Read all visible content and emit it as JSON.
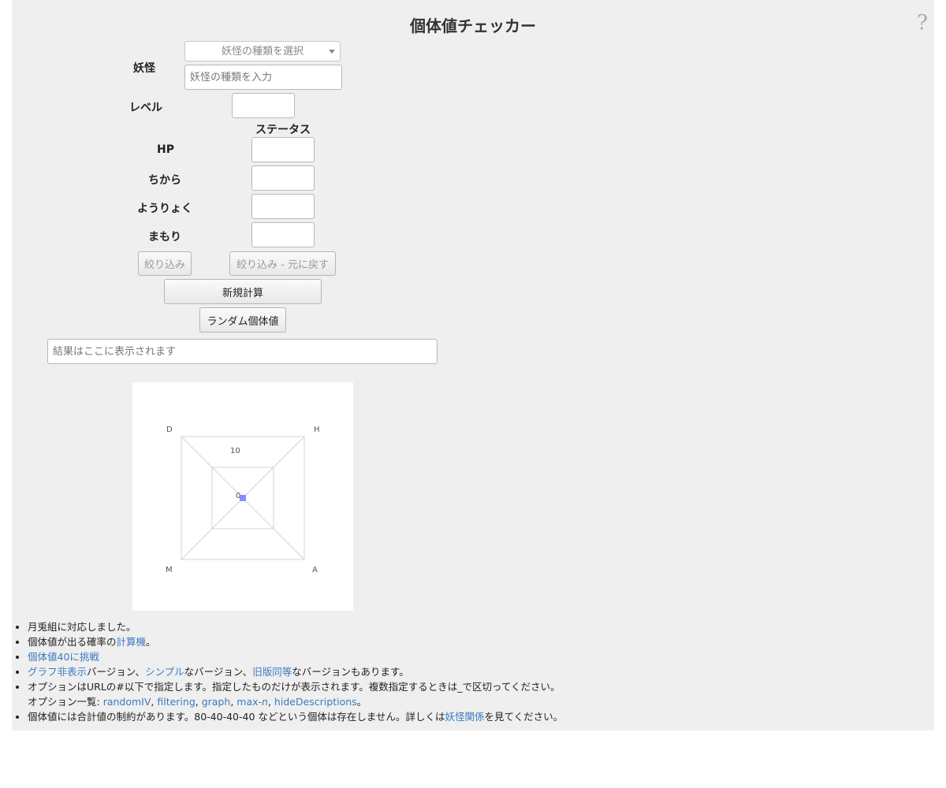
{
  "header": {
    "title": "個体値チェッカー",
    "help": "?"
  },
  "form": {
    "yokai_label": "妖怪",
    "species_select": "妖怪の種類を選択",
    "species_input_placeholder": "妖怪の種類を入力",
    "level_label": "レベル",
    "status_heading": "ステータス",
    "stats": [
      {
        "label": "HP"
      },
      {
        "label": "ちから"
      },
      {
        "label": "ようりょく"
      },
      {
        "label": "まもり"
      }
    ],
    "filter_button": "絞り込み",
    "filter_undo_button": "絞り込み - 元に戻す",
    "new_calc_button": "新規計算",
    "random_iv_button": "ランダム個体値",
    "result_placeholder": "結果はここに表示されます"
  },
  "graph": {
    "axes": [
      "H",
      "A",
      "M",
      "D"
    ],
    "ring_labels": [
      "10",
      "0"
    ],
    "point_color": "#8a8aff"
  },
  "notes": {
    "n1": "月兎組に対応しました。",
    "n2_pre": "個体値が出る確率の",
    "n2_link": "計算機",
    "n2_post": "。",
    "n3_link": "個体値40に挑戦",
    "n4_link1": "グラフ非表示",
    "n4_t1": "バージョン、",
    "n4_link2": "シンプル",
    "n4_t2": "なバージョン、",
    "n4_link3": "旧版同等",
    "n4_t3": "なバージョンもあります。",
    "n5_line1": "オプションはURLの#以下で指定します。指定したものだけが表示されます。複数指定するときは_で区切ってください。",
    "n5_prefix": "オプション一覧: ",
    "n5_opt1": "randomIV",
    "n5_opt2": "filtering",
    "n5_opt3": "graph",
    "n5_opt4a": "max-",
    "n5_opt4b": "n",
    "n5_opt5": "hideDescriptions",
    "sep": ", ",
    "period": "。",
    "n6_pre": "個体値には合計値の制約があります。80-40-40-40 などという個体は存在しません。詳しくは",
    "n6_link": "妖怪関係",
    "n6_post": "を見てください。"
  }
}
